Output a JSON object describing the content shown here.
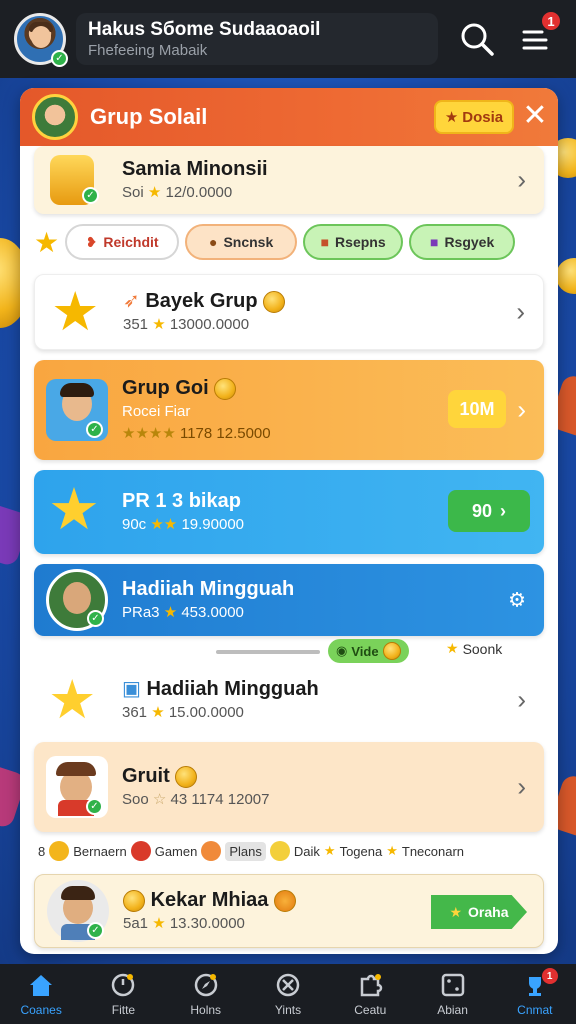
{
  "header": {
    "title": "Hakus Sбоme Sudaaoaoil",
    "subtitle": "Fhefeeing Mabaik",
    "notification_count": "1"
  },
  "panel": {
    "title": "Grup Solail",
    "bonus_label": "Dosia",
    "close_label": "✕"
  },
  "rows": [
    {
      "name": "Samia Minonsii",
      "sub_prefix": "Soi",
      "value": "12/0.0000"
    },
    {
      "name": "Bayek Grup",
      "sub_prefix": "351",
      "value": "13000.0000"
    },
    {
      "name": "Grup Goi",
      "sub_prefix": "Rocei Fiar",
      "value": "1178 12.5000",
      "action": "10M"
    },
    {
      "name": "PR 1 3 bikap",
      "sub_prefix": "90c",
      "value": "19.90000",
      "action": "90"
    },
    {
      "name": "Hadiiah Mingguah",
      "sub_prefix": "PRa3",
      "value": "453.0000"
    },
    {
      "name": "Hadiiah Mingguah",
      "sub_prefix": "361",
      "value": "15.00.0000"
    },
    {
      "name": "Gruit",
      "sub_prefix": "Soo",
      "value": "43 1174 12007"
    },
    {
      "name": "Kekar Mhiaa",
      "sub_prefix": "5a1",
      "value": "13.30.0000",
      "action": "Oraha"
    }
  ],
  "chips": [
    {
      "label": "Reichdit",
      "color": "#ffffff",
      "text_color": "#c0392b",
      "border": "#d6d6d6"
    },
    {
      "label": "Sncnsk",
      "color": "#fde3c6",
      "text_color": "#333333",
      "border": "#f2b27a"
    },
    {
      "label": "Rsepns",
      "color": "#c8f3b6",
      "text_color": "#333333",
      "border": "#6cc55a"
    },
    {
      "label": "Rsgyek",
      "color": "#c8f3b6",
      "text_color": "#333333",
      "border": "#6cc55a"
    }
  ],
  "mini": {
    "chip_label": "Vide",
    "right_label": "Soonk"
  },
  "legend": [
    {
      "label": "Bernaern",
      "color": "#f3b51b"
    },
    {
      "label": "Gamen",
      "color": "#d93a2a"
    },
    {
      "label": "Plans",
      "color": "#f08a3a"
    },
    {
      "label": "Daik",
      "color": "#f3cf3b"
    },
    {
      "label": "Togena",
      "color": "#f3b51b"
    },
    {
      "label": "Tneconarn",
      "color": "#f3b51b"
    }
  ],
  "legend_prefix": "8",
  "nav": [
    {
      "label": "Coanes",
      "icon": "home-icon",
      "active": true
    },
    {
      "label": "Fitte",
      "icon": "clock-icon"
    },
    {
      "label": "Holns",
      "icon": "compass-icon"
    },
    {
      "label": "Yints",
      "icon": "target-icon"
    },
    {
      "label": "Ceatu",
      "icon": "puzzle-icon"
    },
    {
      "label": "Abian",
      "icon": "dice-icon"
    },
    {
      "label": "Cnmat",
      "icon": "trophy-icon",
      "badge": "1"
    }
  ],
  "colors": {
    "header_bg": "#1c1f24",
    "accent": "#39a3ff",
    "panel_header": "#ee6a33",
    "bonus": "#ffd53b"
  }
}
